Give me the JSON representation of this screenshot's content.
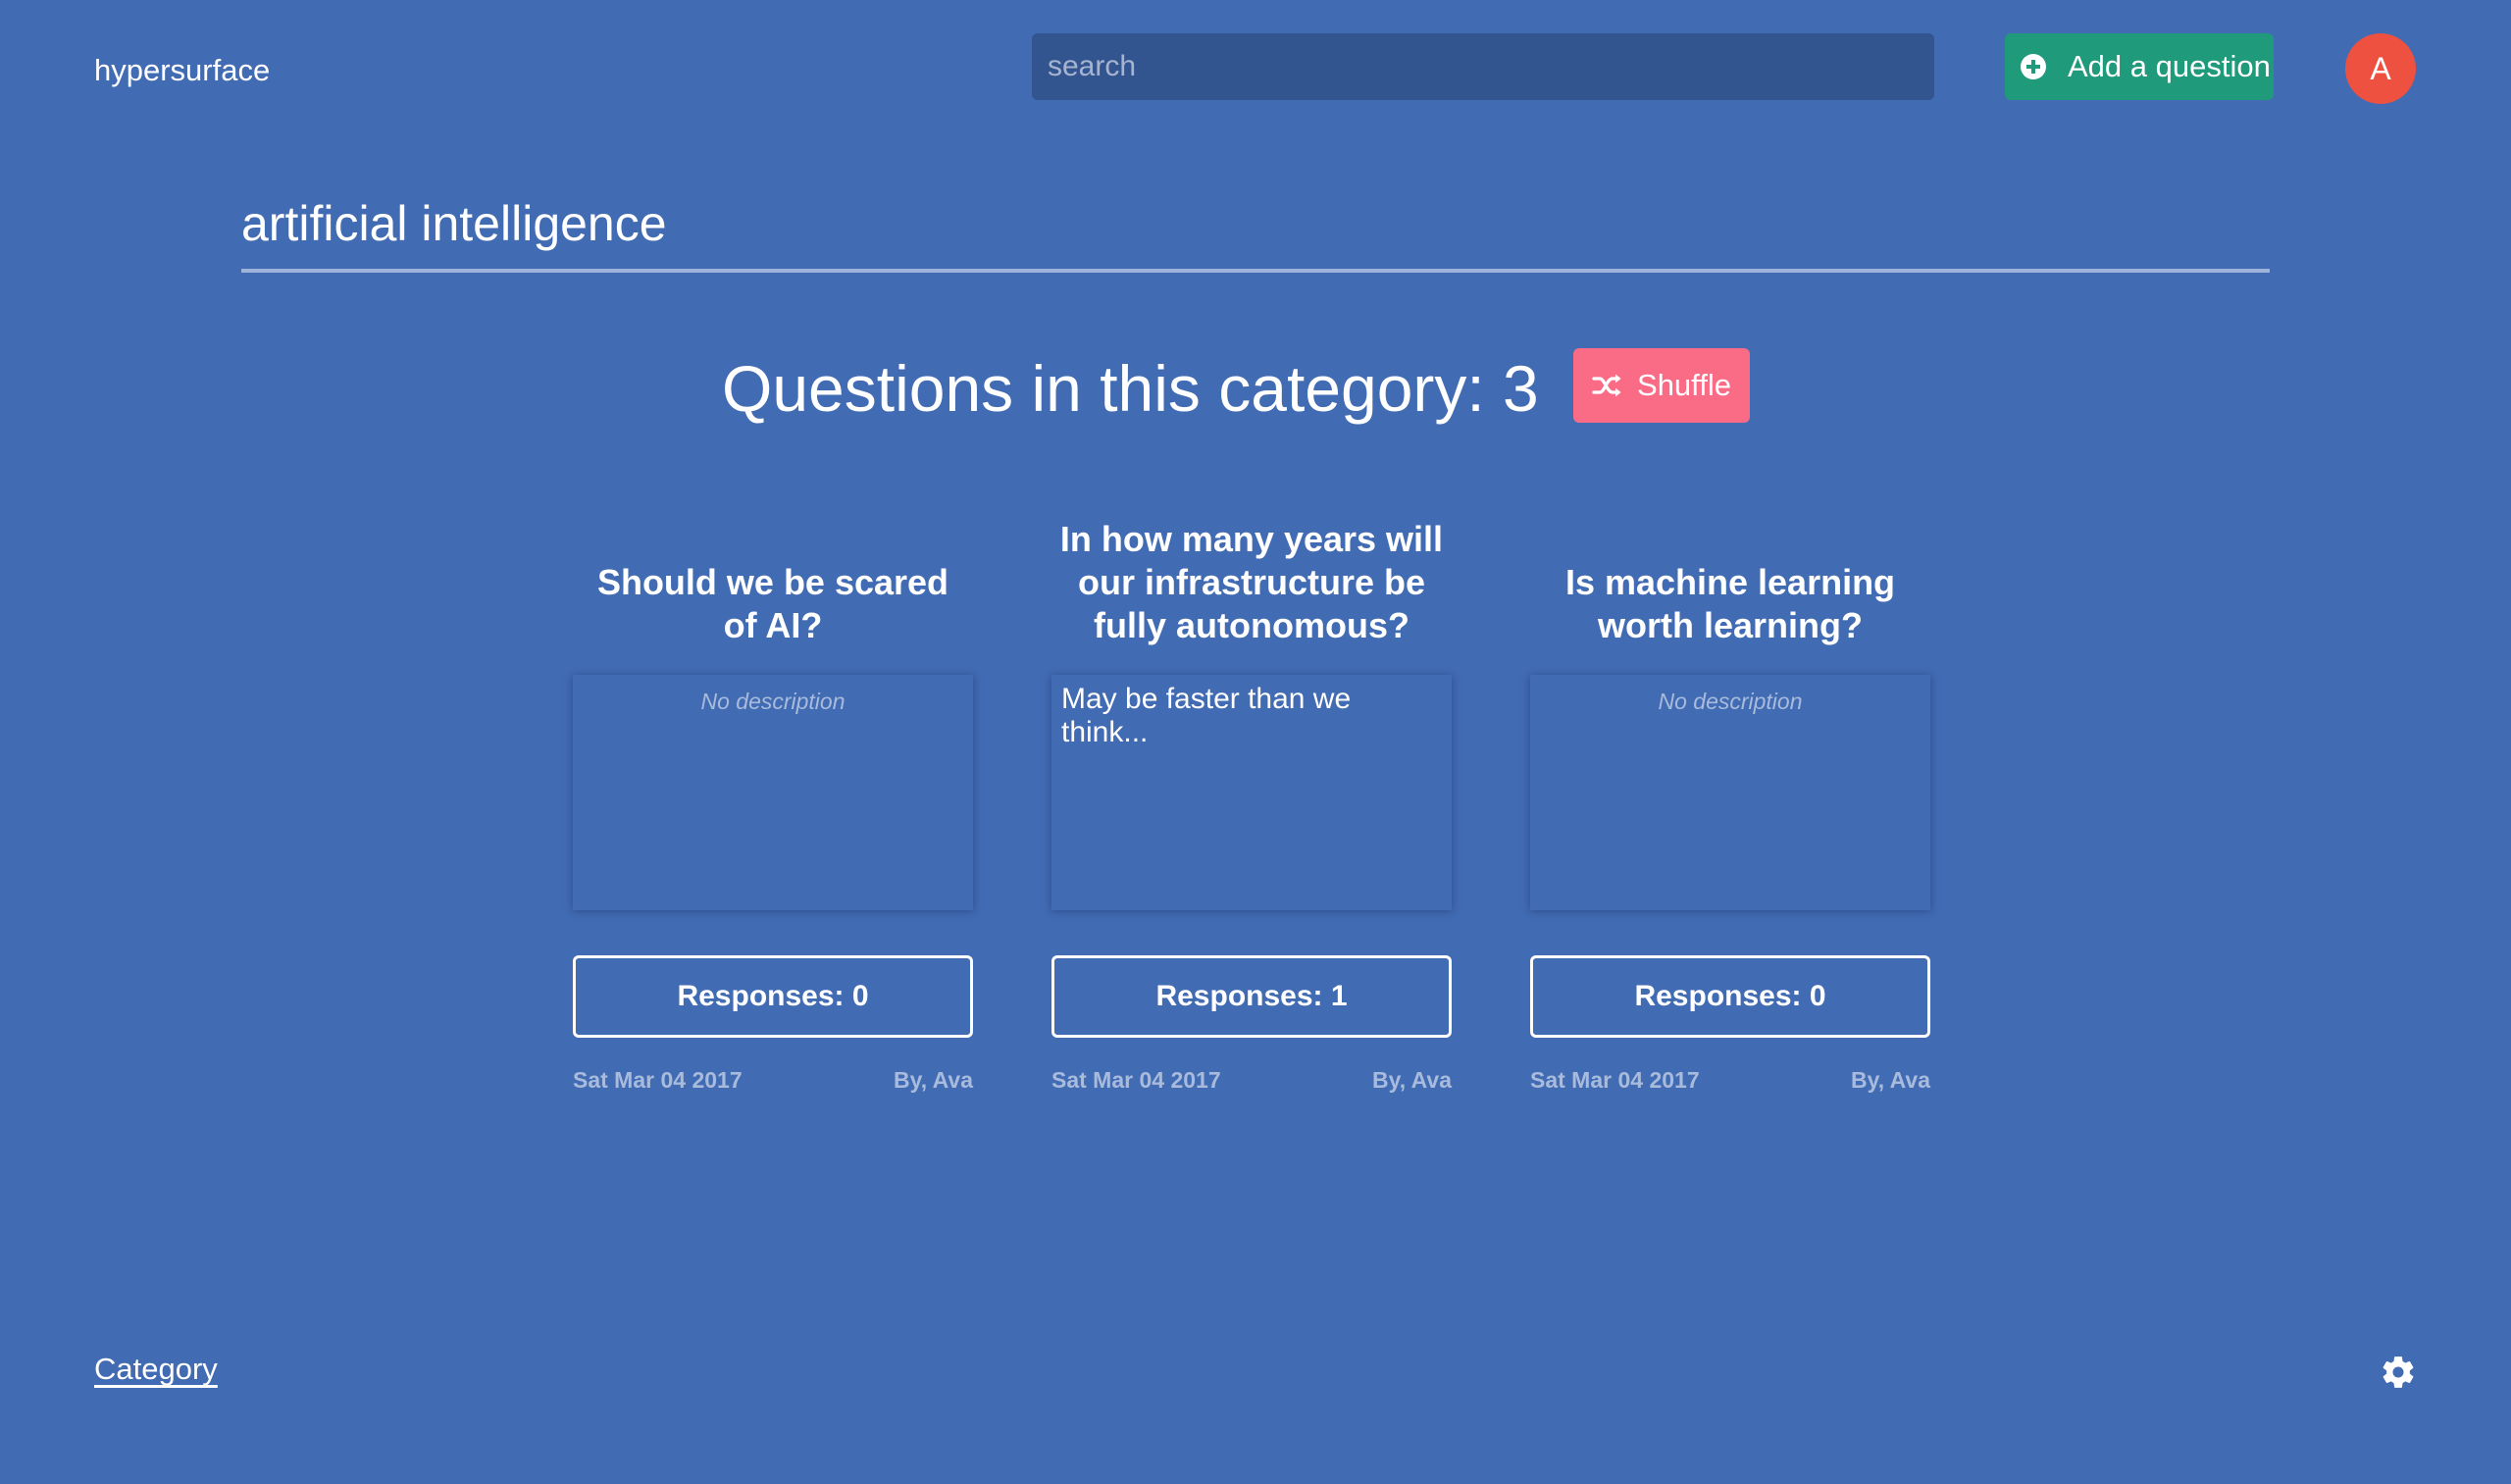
{
  "header": {
    "brand": "hypersurface",
    "search_placeholder": "search",
    "add_question_label": "Add a question",
    "avatar_initial": "A"
  },
  "category": {
    "title": "artificial intelligence",
    "count_label": "Questions in this category: 3",
    "shuffle_label": "Shuffle"
  },
  "questions": [
    {
      "title": "Should we be scared of AI?",
      "description": "No description",
      "has_description": false,
      "responses_label": "Responses: 0",
      "date": "Sat Mar 04 2017",
      "author": "By, Ava"
    },
    {
      "title": "In how many years will our infrastructure be fully autonomous?",
      "description": "May be faster than we think...",
      "has_description": true,
      "responses_label": "Responses: 1",
      "date": "Sat Mar 04 2017",
      "author": "By, Ava"
    },
    {
      "title": "Is machine learning worth learning?",
      "description": "No description",
      "has_description": false,
      "responses_label": "Responses: 0",
      "date": "Sat Mar 04 2017",
      "author": "By, Ava"
    }
  ],
  "footer": {
    "link_label": "Category",
    "settings_icon": "gear-icon"
  },
  "colors": {
    "background": "#416bb3",
    "search_bg": "#33558f",
    "add_button": "#1f9a7b",
    "avatar": "#ee5140",
    "shuffle_button": "#fa6c86",
    "muted_text": "#a9bbdc"
  }
}
